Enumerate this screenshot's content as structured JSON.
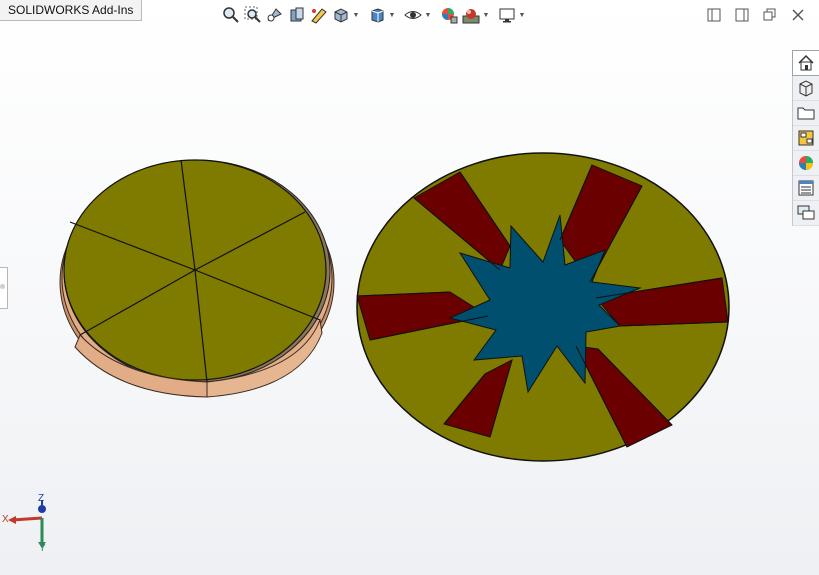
{
  "addins_tab": {
    "label": "SOLIDWORKS Add-Ins"
  },
  "heads_up_toolbar": {
    "items": [
      "zoom-to-fit-icon",
      "zoom-to-area-icon",
      "previous-view-icon",
      "section-view-icon",
      "dynamic-annotation-icon",
      "view-orientation-icon",
      "display-style-icon",
      "hide-show-items-icon",
      "edit-appearance-icon",
      "apply-scene-icon",
      "view-settings-icon"
    ]
  },
  "window_controls": [
    "tile-left-icon",
    "tile-right-icon",
    "restore-icon",
    "close-icon"
  ],
  "task_pane": {
    "items": [
      "home-icon",
      "design-library-icon",
      "file-explorer-icon",
      "view-palette-icon",
      "appearances-icon",
      "custom-properties-icon",
      "forum-icon"
    ]
  },
  "triad": {
    "x_label": "X",
    "y_label": "Y",
    "z_label": "Z"
  },
  "colors": {
    "olive": "#7f7a00",
    "dark_red": "#6b0000",
    "teal": "#004f6e",
    "copper": "#e1ac86",
    "outline": "#111111"
  }
}
